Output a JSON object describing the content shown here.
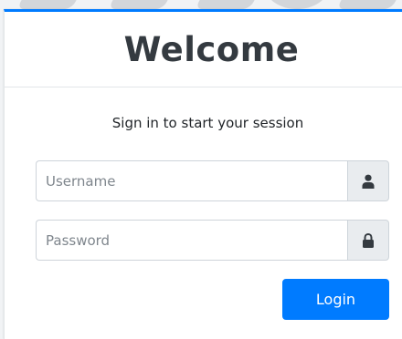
{
  "header": {
    "title": "Welcome"
  },
  "form": {
    "message": "Sign in to start your session",
    "username": {
      "value": "",
      "placeholder": "Username",
      "icon": "user-icon"
    },
    "password": {
      "value": "",
      "placeholder": "Password",
      "icon": "lock-icon"
    },
    "login_label": "Login"
  },
  "colors": {
    "accent": "#007bff",
    "addon_bg": "#e9ecef",
    "border": "#ced4da",
    "title": "#343a40"
  }
}
